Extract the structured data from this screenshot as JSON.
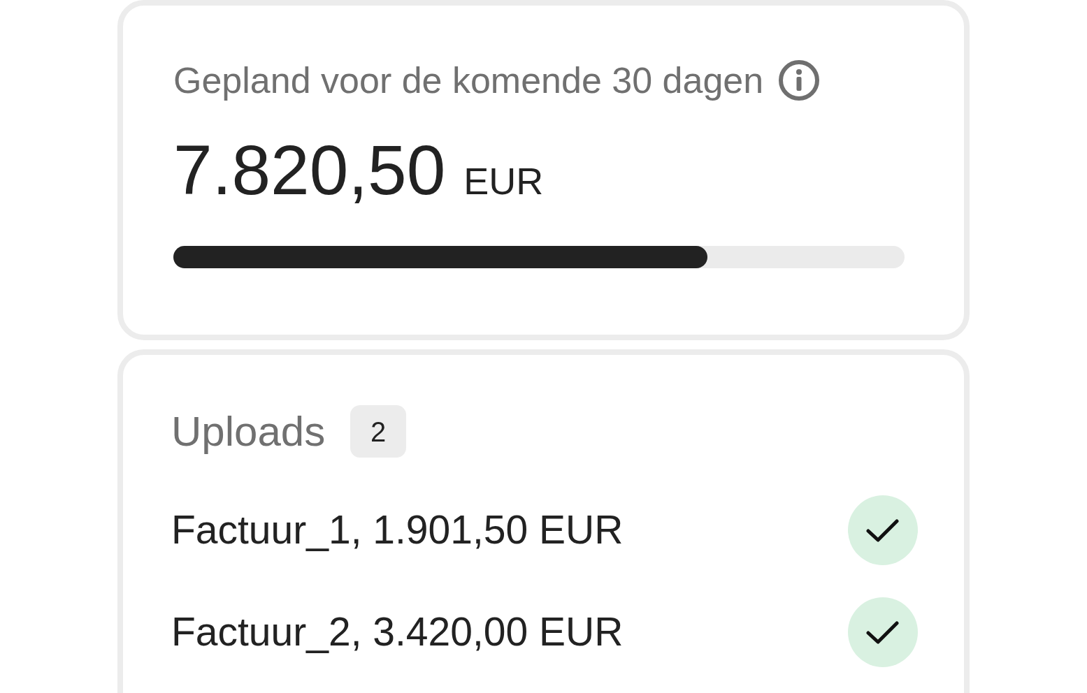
{
  "planned": {
    "title": "Gepland voor de komende 30 dagen",
    "amount": "7.820,50",
    "currency": "EUR",
    "level": 0.73
  },
  "uploads": {
    "title": "Uploads",
    "count": "2",
    "items": [
      {
        "label": "Factuur_1, 1.901,50 EUR",
        "done": true
      },
      {
        "label": "Factuur_2, 3.420,00 EUR",
        "done": true
      }
    ]
  }
}
